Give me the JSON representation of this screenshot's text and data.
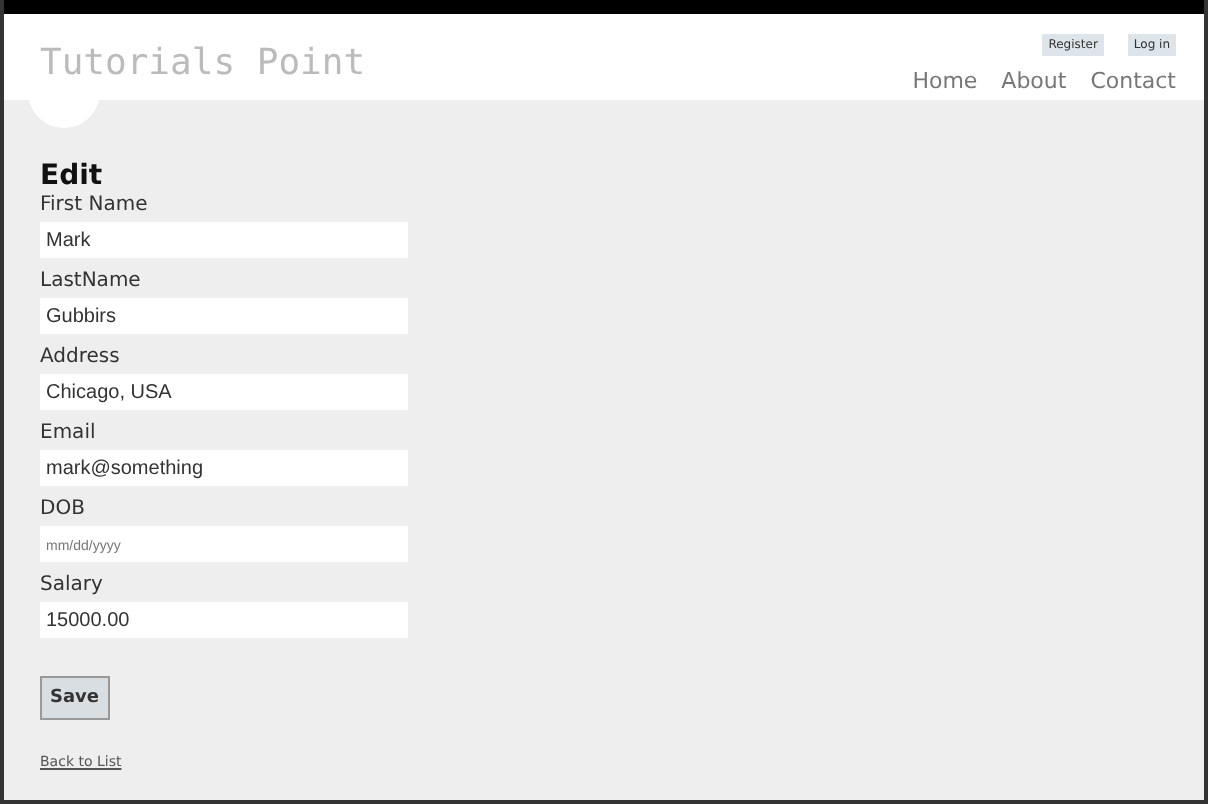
{
  "header": {
    "logo": "Tutorials Point",
    "account_links": [
      "Register",
      "Log in"
    ],
    "nav": [
      "Home",
      "About",
      "Contact"
    ]
  },
  "form": {
    "title": "Edit",
    "fields": [
      {
        "label": "First Name",
        "value": "Mark"
      },
      {
        "label": "LastName",
        "value": "Gubbirs"
      },
      {
        "label": "Address",
        "value": "Chicago, USA"
      },
      {
        "label": "Email",
        "value": "mark@something"
      },
      {
        "label": "DOB",
        "placeholder": "mm/dd/yyyy"
      },
      {
        "label": "Salary",
        "value": "15000.00"
      }
    ],
    "submit": "Save",
    "back_link": "Back to List"
  }
}
